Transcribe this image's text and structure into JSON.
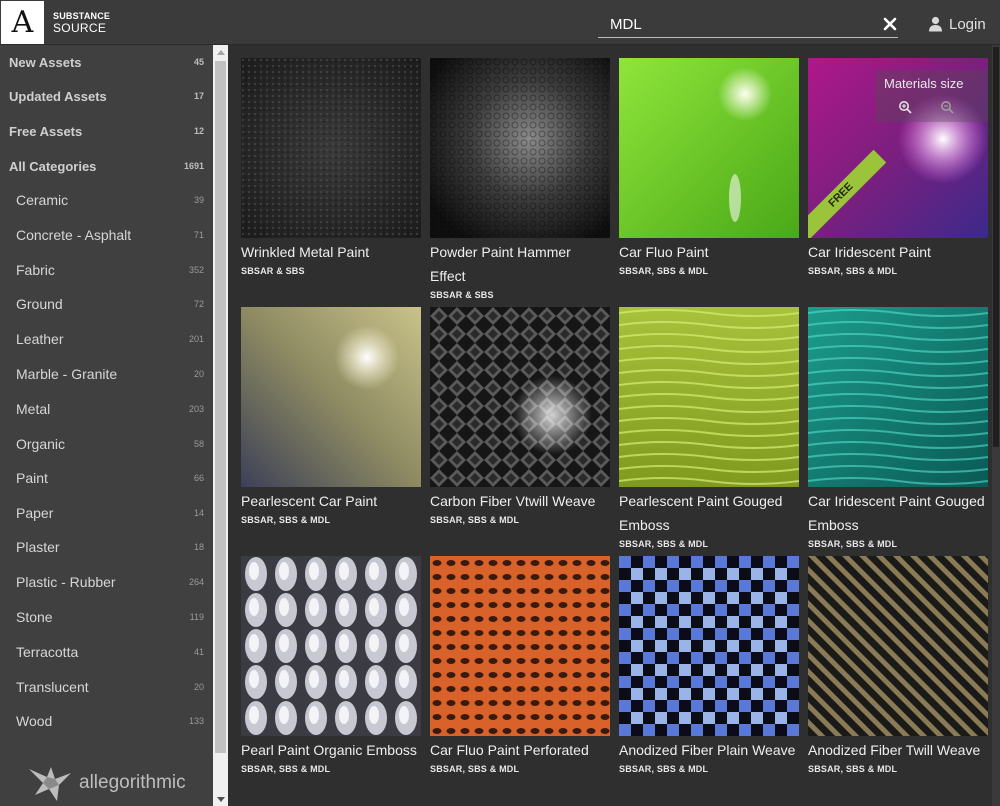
{
  "header": {
    "logo_letter": "A",
    "brand_line1": "SUBSTANCE",
    "brand_line2": "SOURCE",
    "search_value": "MDL",
    "login_label": "Login"
  },
  "sidebar": {
    "main_items": [
      {
        "label": "New Assets",
        "count": "45"
      },
      {
        "label": "Updated Assets",
        "count": "17"
      },
      {
        "label": "Free Assets",
        "count": "12"
      },
      {
        "label": "All Categories",
        "count": "1691"
      }
    ],
    "categories": [
      {
        "label": "Ceramic",
        "count": "39"
      },
      {
        "label": "Concrete - Asphalt",
        "count": "71"
      },
      {
        "label": "Fabric",
        "count": "352"
      },
      {
        "label": "Ground",
        "count": "72"
      },
      {
        "label": "Leather",
        "count": "201"
      },
      {
        "label": "Marble - Granite",
        "count": "20"
      },
      {
        "label": "Metal",
        "count": "203"
      },
      {
        "label": "Organic",
        "count": "58"
      },
      {
        "label": "Paint",
        "count": "66"
      },
      {
        "label": "Paper",
        "count": "14"
      },
      {
        "label": "Plaster",
        "count": "18"
      },
      {
        "label": "Plastic - Rubber",
        "count": "264"
      },
      {
        "label": "Stone",
        "count": "119"
      },
      {
        "label": "Terracotta",
        "count": "41"
      },
      {
        "label": "Translucent",
        "count": "20"
      },
      {
        "label": "Wood",
        "count": "133"
      }
    ],
    "footer_logo_text": "allegorithmic"
  },
  "overlay": {
    "materials_size_label": "Materials size",
    "free_badge": "FREE"
  },
  "materials": [
    {
      "title": "Wrinkled Metal Paint",
      "formats": "SBSAR & SBS"
    },
    {
      "title": "Powder Paint Hammer Effect",
      "formats": "SBSAR & SBS"
    },
    {
      "title": "Car Fluo Paint",
      "formats": "SBSAR, SBS & MDL"
    },
    {
      "title": "Car Iridescent Paint",
      "formats": "SBSAR, SBS & MDL"
    },
    {
      "title": "Pearlescent Car Paint",
      "formats": "SBSAR, SBS & MDL"
    },
    {
      "title": "Carbon Fiber Vtwill Weave",
      "formats": "SBSAR, SBS & MDL"
    },
    {
      "title": "Pearlescent Paint Gouged Emboss",
      "formats": "SBSAR, SBS & MDL"
    },
    {
      "title": "Car Iridescent Paint Gouged Emboss",
      "formats": "SBSAR, SBS & MDL"
    },
    {
      "title": "Pearl Paint Organic Emboss",
      "formats": "SBSAR, SBS & MDL"
    },
    {
      "title": "Car Fluo Paint Perforated",
      "formats": "SBSAR, SBS & MDL"
    },
    {
      "title": "Anodized Fiber Plain Weave",
      "formats": "SBSAR, SBS & MDL"
    },
    {
      "title": "Anodized Fiber Twill Weave",
      "formats": "SBSAR, SBS & MDL"
    }
  ],
  "colors": {
    "header_bg": "#3b3b3b",
    "sidebar_bg": "#404040",
    "grid_bg": "#2f2f2f",
    "free_ribbon": "#9bc43a"
  }
}
